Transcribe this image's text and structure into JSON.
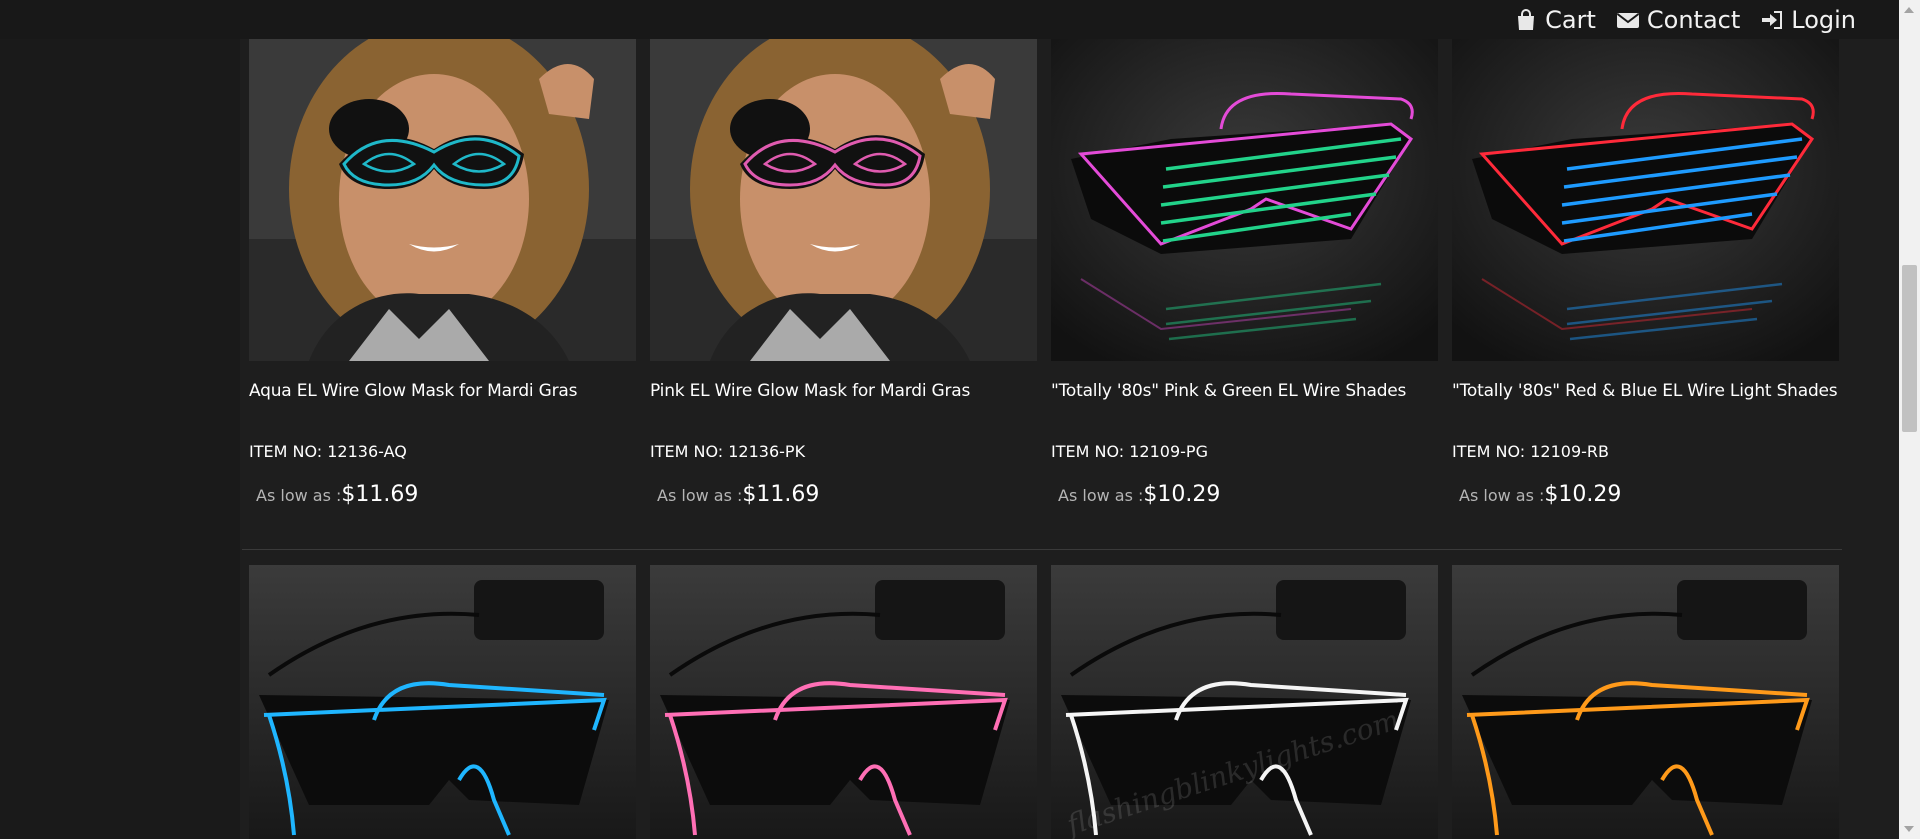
{
  "nav": {
    "cart_label": "Cart",
    "contact_label": "Contact",
    "login_label": "Login",
    "cart_icon": "shopping-bag-icon",
    "contact_icon": "envelope-icon",
    "login_icon": "sign-in-icon"
  },
  "products_row1": [
    {
      "title": "Aqua EL Wire Glow Mask for Mardi Gras",
      "item_no": "ITEM NO: 12136-AQ",
      "price_label": "As low as :",
      "price": "$11.69",
      "color": "#1fb8c9",
      "image": "mask-model-image"
    },
    {
      "title": "Pink EL Wire Glow Mask for Mardi Gras",
      "item_no": "ITEM NO: 12136-PK",
      "price_label": "As low as :",
      "price": "$11.69",
      "color": "#e05bb0",
      "image": "mask-model-image"
    },
    {
      "title": "\"Totally '80s\" Pink & Green EL Wire Shades",
      "item_no": "ITEM NO: 12109-PG",
      "price_label": "As low as :",
      "price": "$10.29",
      "color": "#22d38a",
      "frame_color": "#e44bd8",
      "image": "shutter-shades-image"
    },
    {
      "title": "\"Totally '80s\" Red & Blue EL Wire Light Shades",
      "item_no": "ITEM NO: 12109-RB",
      "price_label": "As low as :",
      "price": "$10.29",
      "color": "#1e9bff",
      "frame_color": "#ff2a3a",
      "image": "shutter-shades-image"
    }
  ],
  "products_row2": [
    {
      "color": "#1fb6ff",
      "image": "el-wire-sunglasses-image"
    },
    {
      "color": "#ff6fb5",
      "image": "el-wire-sunglasses-image"
    },
    {
      "color": "#f5f5f5",
      "image": "el-wire-sunglasses-image",
      "watermark": "flashingblinkylights.com"
    },
    {
      "color": "#ff9a1a",
      "image": "el-wire-sunglasses-image"
    }
  ]
}
